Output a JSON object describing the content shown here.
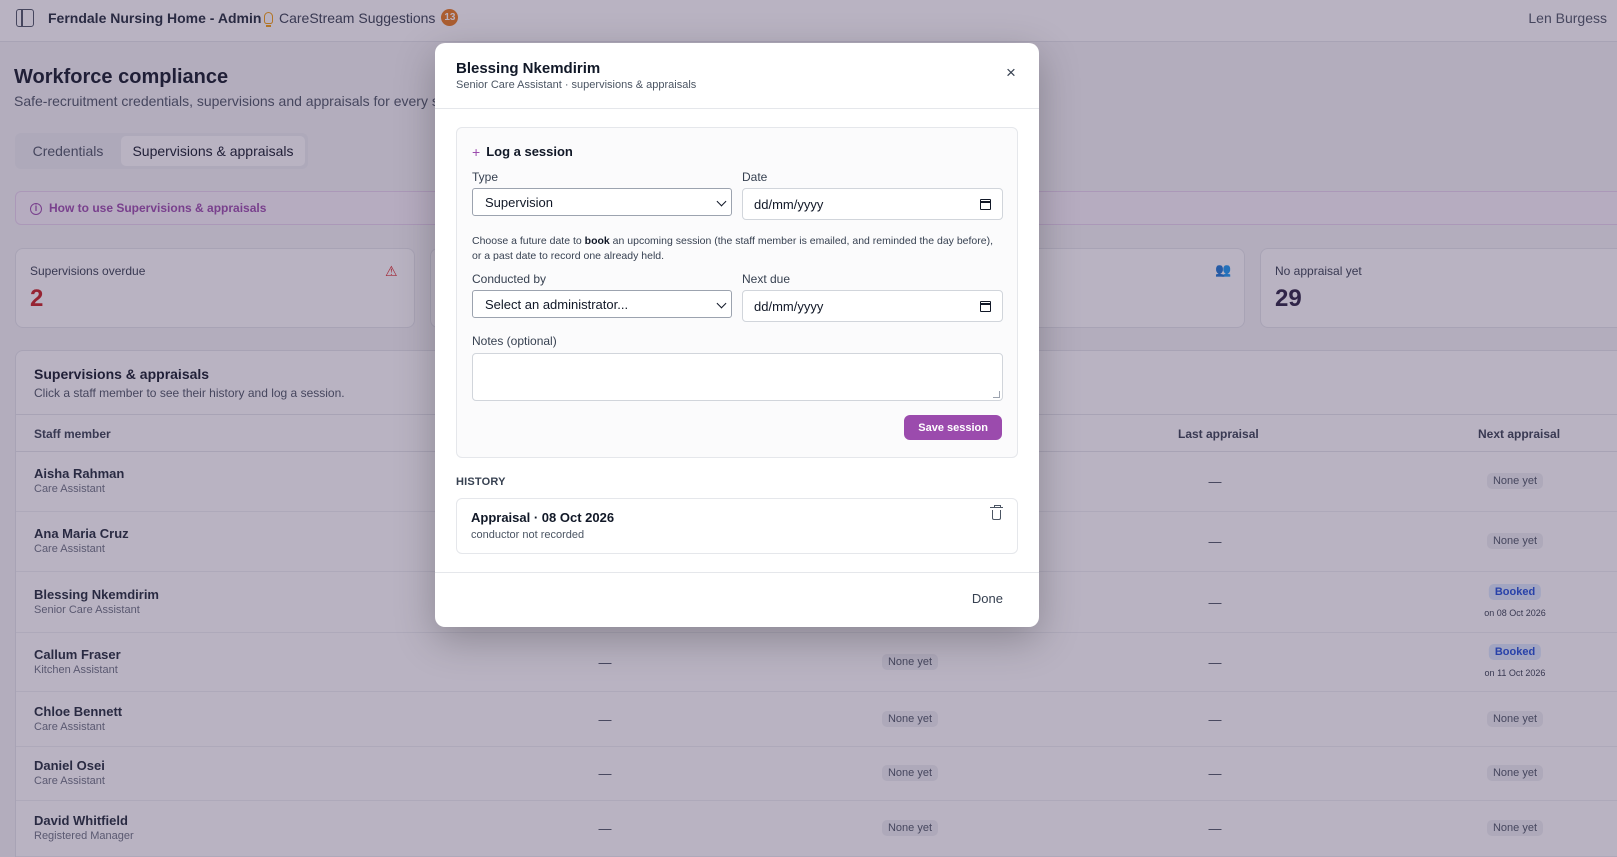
{
  "topbar": {
    "app_title": "Ferndale Nursing Home - Admin",
    "suggestions_label": "CareStream Suggestions",
    "suggestions_count": "13",
    "user_name": "Len Burgess"
  },
  "page": {
    "title": "Workforce compliance",
    "subtitle": "Safe-recruitment credentials, supervisions and appraisals for every sta",
    "tabs": [
      "Credentials",
      "Supervisions & appraisals"
    ],
    "active_tab": "Supervisions & appraisals",
    "howto": "How to use Supervisions & appraisals"
  },
  "stats": [
    {
      "label": "Supervisions overdue",
      "value": "2",
      "value_color": "#c81e1e",
      "icon": "warning-icon"
    },
    {
      "label": "No appraisal yet",
      "value": "29",
      "value_color": "#2a2140",
      "icon": "none"
    }
  ],
  "table": {
    "title": "Supervisions & appraisals",
    "subtitle": "Click a staff member to see their history and log a session.",
    "headers": {
      "staff": "Staff member",
      "last_appraisal": "Last appraisal",
      "next_appraisal": "Next appraisal"
    },
    "rows": [
      {
        "name": "Aisha Rahman",
        "role": "Care Assistant",
        "c_supervision": "",
        "c_next_supervision": "",
        "last_appraisal": "—",
        "next_appraisal": "None yet",
        "booked_date": ""
      },
      {
        "name": "Ana Maria Cruz",
        "role": "Care Assistant",
        "c_supervision": "",
        "c_next_supervision": "",
        "last_appraisal": "—",
        "next_appraisal": "None yet",
        "booked_date": ""
      },
      {
        "name": "Blessing Nkemdirim",
        "role": "Senior Care Assistant",
        "c_supervision": "",
        "c_next_supervision": "",
        "last_appraisal": "—",
        "next_appraisal": "Booked",
        "booked_date": "on 08 Oct 2026"
      },
      {
        "name": "Callum Fraser",
        "role": "Kitchen Assistant",
        "c_supervision": "—",
        "c_next_supervision": "None yet",
        "last_appraisal": "—",
        "next_appraisal": "Booked",
        "booked_date": "on 11 Oct 2026"
      },
      {
        "name": "Chloe Bennett",
        "role": "Care Assistant",
        "c_supervision": "—",
        "c_next_supervision": "None yet",
        "last_appraisal": "—",
        "next_appraisal": "None yet",
        "booked_date": ""
      },
      {
        "name": "Daniel Osei",
        "role": "Care Assistant",
        "c_supervision": "—",
        "c_next_supervision": "None yet",
        "last_appraisal": "—",
        "next_appraisal": "None yet",
        "booked_date": ""
      },
      {
        "name": "David Whitfield",
        "role": "Registered Manager",
        "c_supervision": "—",
        "c_next_supervision": "None yet",
        "last_appraisal": "—",
        "next_appraisal": "None yet",
        "booked_date": ""
      }
    ]
  },
  "modal": {
    "title": "Blessing Nkemdirim",
    "subtitle": "Senior Care Assistant · supervisions & appraisals",
    "close_label": "×",
    "log": {
      "title": "Log a session",
      "type_label": "Type",
      "type_value": "Supervision",
      "date_label": "Date",
      "date_placeholder": "dd/mm/yyyy",
      "help_prefix": "Choose a future date to ",
      "help_bold": "book",
      "help_suffix": " an upcoming session (the staff member is emailed, and reminded the day before), or a past date to record one already held.",
      "conducted_label": "Conducted by",
      "conducted_value": "Select an administrator...",
      "next_due_label": "Next due",
      "next_due_placeholder": "dd/mm/yyyy",
      "notes_label": "Notes (optional)",
      "save_label": "Save session"
    },
    "history_label": "HISTORY",
    "history": [
      {
        "title": "Appraisal · 08 Oct 2026",
        "sub": "conductor not recorded"
      }
    ],
    "done_label": "Done"
  }
}
